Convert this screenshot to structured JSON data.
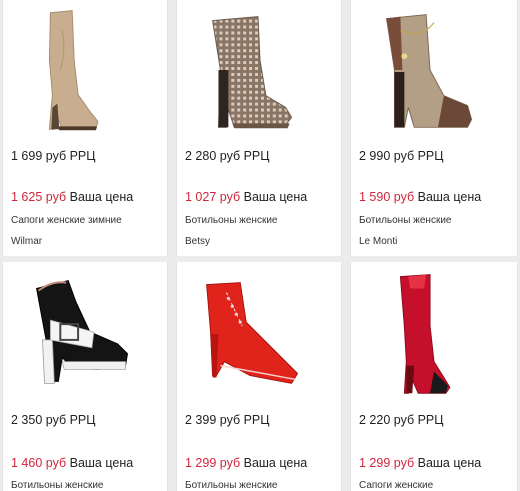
{
  "products": [
    {
      "rrc_price": "1 699 руб РРЦ",
      "our_price": "1 625 руб",
      "our_label": "Ваша цена",
      "name": "Сапоги женские зимние",
      "brand": "Wilmar",
      "icon": "tall-beige-wedge-boot-icon",
      "color": "#c8ad8f"
    },
    {
      "rrc_price": "2 280 руб РРЦ",
      "our_price": "1 027 руб",
      "our_label": "Ваша цена",
      "name": "Ботильоны женские",
      "brand": "Betsy",
      "icon": "perforated-peep-toe-bootie-icon",
      "color": "#8a7565"
    },
    {
      "rrc_price": "2 990 руб РРЦ",
      "our_price": "1 590 руб",
      "our_label": "Ваша цена",
      "name": "Ботильоны женские",
      "brand": "Le Monti",
      "icon": "beige-croc-bootie-icon",
      "color": "#a69178"
    },
    {
      "rrc_price": "2 350 руб РРЦ",
      "our_price": "1 460 руб",
      "our_label": "Ваша цена",
      "name": "Ботильоны женские",
      "brand": "",
      "icon": "black-white-platform-bootie-icon",
      "color": "#111111"
    },
    {
      "rrc_price": "2 399 руб РРЦ",
      "our_price": "1 299 руб",
      "our_label": "Ваша цена",
      "name": "Ботильоны женские",
      "brand": "",
      "icon": "red-patent-lace-up-bootie-icon",
      "color": "#e0241c"
    },
    {
      "rrc_price": "2 220 руб РРЦ",
      "our_price": "1 299 руб",
      "our_label": "Ваша цена",
      "name": "Сапоги женские",
      "brand": "",
      "icon": "red-knee-high-boot-icon",
      "color": "#c4102a"
    }
  ],
  "colors": {
    "sale_price": "#d0263b",
    "background": "#ececec",
    "card": "#ffffff"
  }
}
